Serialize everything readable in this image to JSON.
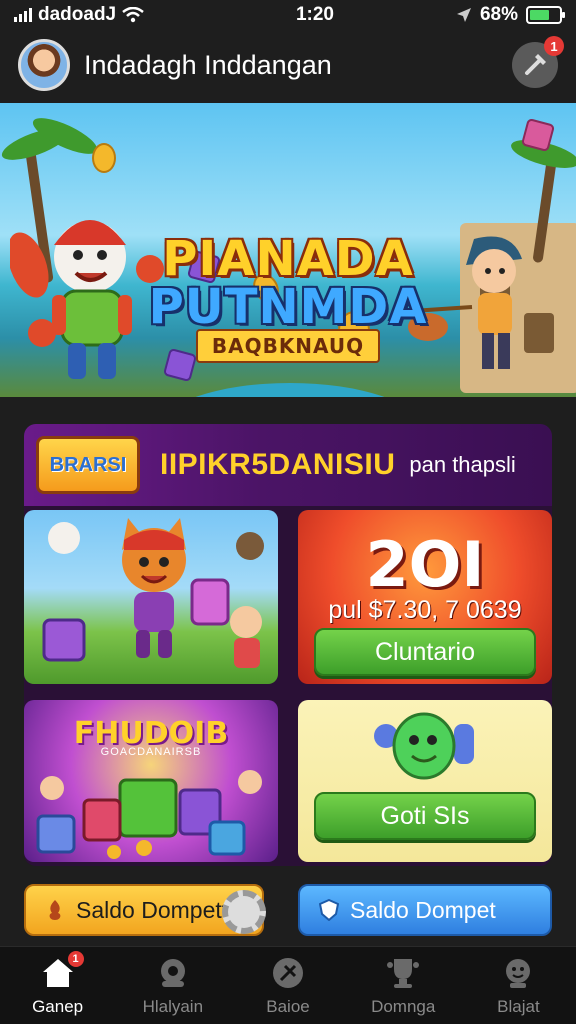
{
  "status_bar": {
    "carrier": "dadoadJ",
    "time": "1:20",
    "battery_pct": "68%",
    "battery_level": 0.68,
    "icons": [
      "signal-icon",
      "wifi-icon",
      "location-arrow-icon",
      "battery-icon"
    ]
  },
  "header": {
    "title": "Indadagh Inddangan",
    "notification_count": "1",
    "tool_icon": "hammer-icon"
  },
  "banner": {
    "title_line1": "PIANADA",
    "title_line2": "PUTNMDA",
    "subtitle": "BAQBKNAUQ"
  },
  "promo": {
    "badge": "BRARSI",
    "title": "IIPIKR5DANISIU",
    "subtitle": "pan thapsli"
  },
  "cards": {
    "prize_card": {
      "big_text": "2OI",
      "prize_text": "pul $7.30, 7 0639",
      "button_label": "Cluntario"
    },
    "mystery_card": {
      "title": "FHUDOIB",
      "subtitle": "GOACDANAIRSB"
    },
    "goti_card": {
      "button_label": "Goti SIs"
    }
  },
  "wallet_buttons": [
    {
      "label": "Saldo Dompett",
      "icon": "wallet-icon"
    },
    {
      "label": "Saldo Dompet",
      "icon": "shield-icon"
    }
  ],
  "bottom_nav": [
    {
      "label": "Ganep",
      "icon": "home-icon",
      "active": true,
      "badge": "1"
    },
    {
      "label": "Hlalyain",
      "icon": "controller-icon",
      "active": false
    },
    {
      "label": "Baioe",
      "icon": "star-badge-icon",
      "active": false
    },
    {
      "label": "Domnga",
      "icon": "trophy-icon",
      "active": false
    },
    {
      "label": "Blajat",
      "icon": "profile-icon",
      "active": false
    }
  ],
  "colors": {
    "background": "#1e1e1e",
    "accent_yellow": "#ffd12a",
    "accent_green": "#3d9f2a",
    "accent_blue": "#2f7fe0",
    "promo_purple": "#4b1466",
    "badge_red": "#e53935"
  }
}
